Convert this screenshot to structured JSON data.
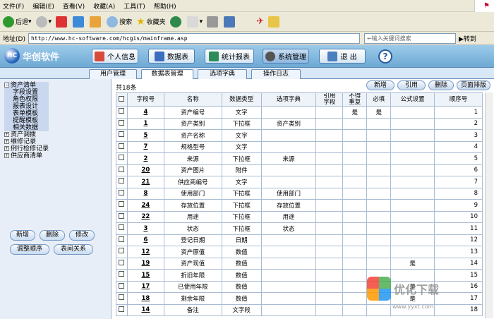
{
  "menu": [
    "文件(F)",
    "编辑(E)",
    "查看(V)",
    "收藏(A)",
    "工具(T)",
    "帮助(H)"
  ],
  "toolbar": {
    "back": "后退",
    "search": "搜索",
    "favorites": "收藏夹"
  },
  "address": {
    "label": "地址(D)",
    "url": "http://www.hc-software.com/hcgis/mainframe.asp",
    "search_placeholder": "←输入关键词搜索",
    "go": "转到"
  },
  "header": {
    "logo": "华创软件",
    "buttons": [
      "个人信息",
      "数据表",
      "统计报表",
      "系统管理",
      "退 出"
    ],
    "help": "?"
  },
  "tabs": [
    "用户管理",
    "数据表管理",
    "选项字典",
    "操作日志"
  ],
  "sidebar": {
    "tree": [
      {
        "label": "资产清单",
        "expander": "⊟",
        "level": 0,
        "selected": true
      },
      {
        "label": "字段设置",
        "level": 1,
        "selected": true
      },
      {
        "label": "角色权限",
        "level": 1,
        "selected": true
      },
      {
        "label": "报表设计",
        "level": 1,
        "selected": true
      },
      {
        "label": "表单模板",
        "level": 1,
        "selected": true
      },
      {
        "label": "提醒模板",
        "level": 1,
        "selected": true
      },
      {
        "label": "相关数据",
        "level": 1,
        "selected": true
      },
      {
        "label": "资产调拨",
        "expander": "⊞",
        "level": 0
      },
      {
        "label": "维修记录",
        "expander": "⊞",
        "level": 0
      },
      {
        "label": "例行检修记录",
        "expander": "⊞",
        "level": 0
      },
      {
        "label": "供应商清单",
        "expander": "⊞",
        "level": 0
      }
    ],
    "buttons": {
      "add": "新增",
      "delete": "删除",
      "edit": "修改",
      "reorder": "调整顺序",
      "relation": "表间关系"
    }
  },
  "main": {
    "count": "共18条",
    "actions": {
      "add": "新增",
      "import": "引用",
      "delete": "删除",
      "page_sort": "页面排版"
    },
    "columns": [
      "",
      "字段号",
      "名称",
      "数据类型",
      "选项字典",
      "引用\n字段",
      "不得\n重复",
      "必填",
      "公式设置",
      "顺序号"
    ],
    "rows": [
      {
        "id": "4",
        "name": "资产编号",
        "type": "文字",
        "dict": "",
        "ref": "",
        "unique": "是",
        "required": "是",
        "formula": "",
        "order": "1"
      },
      {
        "id": "1",
        "name": "资产类别",
        "type": "下拉框",
        "dict": "资产类别",
        "ref": "",
        "unique": "",
        "required": "",
        "formula": "",
        "order": "2"
      },
      {
        "id": "5",
        "name": "资产名称",
        "type": "文字",
        "dict": "",
        "ref": "",
        "unique": "",
        "required": "",
        "formula": "",
        "order": "3"
      },
      {
        "id": "7",
        "name": "规格型号",
        "type": "文字",
        "dict": "",
        "ref": "",
        "unique": "",
        "required": "",
        "formula": "",
        "order": "4"
      },
      {
        "id": "2",
        "name": "来源",
        "type": "下拉框",
        "dict": "来源",
        "ref": "",
        "unique": "",
        "required": "",
        "formula": "",
        "order": "5"
      },
      {
        "id": "20",
        "name": "资产图片",
        "type": "附件",
        "dict": "",
        "ref": "",
        "unique": "",
        "required": "",
        "formula": "",
        "order": "6"
      },
      {
        "id": "21",
        "name": "供应商编号",
        "type": "文字",
        "dict": "",
        "ref": "",
        "unique": "",
        "required": "",
        "formula": "",
        "order": "7"
      },
      {
        "id": "8",
        "name": "使用部门",
        "type": "下拉框",
        "dict": "使用部门",
        "ref": "",
        "unique": "",
        "required": "",
        "formula": "",
        "order": "8"
      },
      {
        "id": "24",
        "name": "存放位置",
        "type": "下拉框",
        "dict": "存放位置",
        "ref": "",
        "unique": "",
        "required": "",
        "formula": "",
        "order": "9"
      },
      {
        "id": "22",
        "name": "用途",
        "type": "下拉框",
        "dict": "用途",
        "ref": "",
        "unique": "",
        "required": "",
        "formula": "",
        "order": "10"
      },
      {
        "id": "3",
        "name": "状态",
        "type": "下拉框",
        "dict": "状态",
        "ref": "",
        "unique": "",
        "required": "",
        "formula": "",
        "order": "11"
      },
      {
        "id": "6",
        "name": "登记日期",
        "type": "日期",
        "dict": "",
        "ref": "",
        "unique": "",
        "required": "",
        "formula": "",
        "order": "12"
      },
      {
        "id": "12",
        "name": "资产原值",
        "type": "数值",
        "dict": "",
        "ref": "",
        "unique": "",
        "required": "",
        "formula": "",
        "order": "13"
      },
      {
        "id": "19",
        "name": "资产现值",
        "type": "数值",
        "dict": "",
        "ref": "",
        "unique": "",
        "required": "",
        "formula": "是",
        "order": "14"
      },
      {
        "id": "15",
        "name": "折旧年限",
        "type": "数值",
        "dict": "",
        "ref": "",
        "unique": "",
        "required": "",
        "formula": "",
        "order": "15"
      },
      {
        "id": "17",
        "name": "已使用年限",
        "type": "数值",
        "dict": "",
        "ref": "",
        "unique": "",
        "required": "",
        "formula": "是",
        "order": "16"
      },
      {
        "id": "18",
        "name": "剩余年限",
        "type": "数值",
        "dict": "",
        "ref": "",
        "unique": "",
        "required": "",
        "formula": "是",
        "order": "17"
      },
      {
        "id": "14",
        "name": "备注",
        "type": "文字段",
        "dict": "",
        "ref": "",
        "unique": "",
        "required": "",
        "formula": "",
        "order": "18"
      }
    ]
  },
  "watermark": {
    "text": "优化下载",
    "url": "www.yyxt.com"
  }
}
